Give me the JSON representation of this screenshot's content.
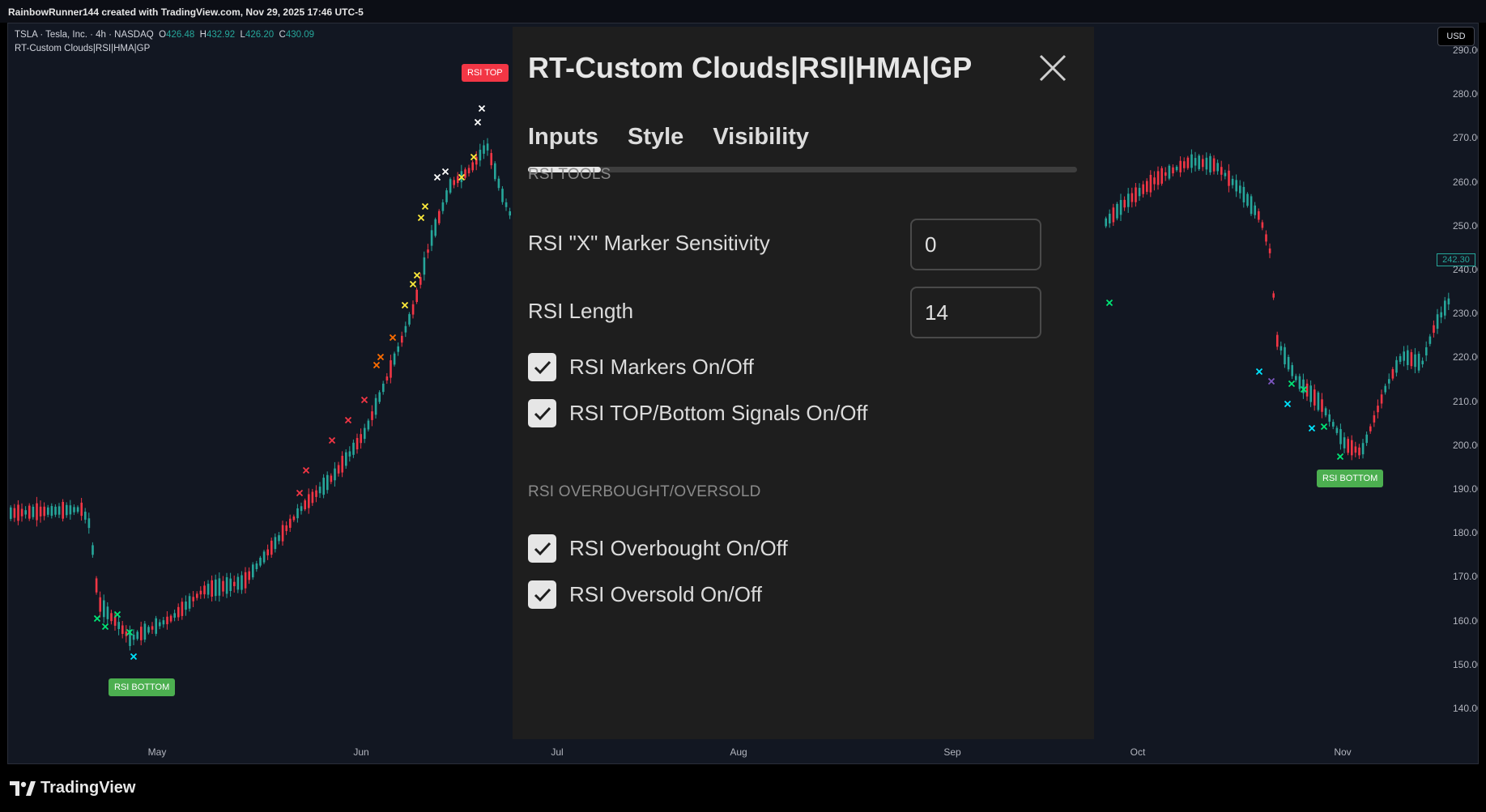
{
  "topbar": {
    "text": "RainbowRunner144 created with TradingView.com, Nov 29, 2025 17:46 UTC-5"
  },
  "legend": {
    "symbol": "TSLA · Tesla, Inc. · 4h · NASDAQ",
    "open_k": "O",
    "open_v": "426.48",
    "high_k": "H",
    "high_v": "432.92",
    "low_k": "L",
    "low_v": "426.20",
    "close_k": "C",
    "close_v": "430.09",
    "indicator": "RT-Custom Clouds|RSI|HMA|GP"
  },
  "currency": "USD",
  "price_axis": [
    "290.00",
    "280.00",
    "270.00",
    "260.00",
    "250.00",
    "240.00",
    "230.00",
    "220.00",
    "210.00",
    "200.00",
    "190.00",
    "180.00",
    "170.00",
    "160.00",
    "150.00",
    "140.00"
  ],
  "last_price": "242.30",
  "time_axis": [
    "May",
    "Jun",
    "Jul",
    "Aug",
    "Sep",
    "Oct",
    "Nov"
  ],
  "signals": {
    "top": "RSI TOP",
    "bottom_1": "RSI BOTTOM",
    "bottom_2": "RSI BOTTOM"
  },
  "dialog": {
    "title": "RT-Custom Clouds|RSI|HMA|GP",
    "tabs": [
      "Inputs",
      "Style",
      "Visibility"
    ],
    "section_1": "RSI TOOLS",
    "sensitivity_label": "RSI \"X\" Marker Sensitivity",
    "sensitivity_value": "0",
    "length_label": "RSI Length",
    "length_value": "14",
    "markers_label": "RSI Markers On/Off",
    "signals_label": "RSI TOP/Bottom Signals On/Off",
    "section_2": "RSI OVERBOUGHT/OVERSOLD",
    "overbought_label": "RSI Overbought On/Off",
    "oversold_label": "RSI Oversold On/Off",
    "checks": {
      "markers": true,
      "signals": true,
      "overbought": true,
      "oversold": true
    }
  },
  "brand": {
    "name": "TradingView"
  },
  "colors": {
    "up": "#26a69a",
    "down": "#f23645",
    "bg": "#121722",
    "dialog": "#1e1e1e"
  }
}
